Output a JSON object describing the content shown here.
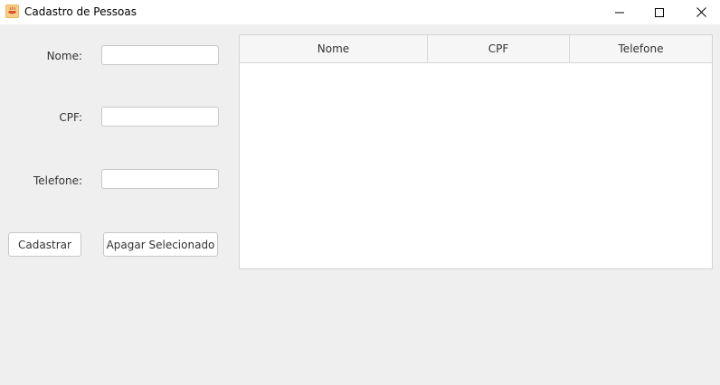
{
  "window": {
    "title": "Cadastro de Pessoas",
    "icon": "java-cup-icon",
    "accent": "#f0a33a"
  },
  "form": {
    "nome_label": "Nome:",
    "cpf_label": "CPF:",
    "telefone_label": "Telefone:",
    "nome_value": "",
    "cpf_value": "",
    "telefone_value": ""
  },
  "buttons": {
    "cadastrar": "Cadastrar",
    "apagar": "Apagar Selecionado"
  },
  "table": {
    "columns": [
      "Nome",
      "CPF",
      "Telefone"
    ],
    "rows": []
  }
}
